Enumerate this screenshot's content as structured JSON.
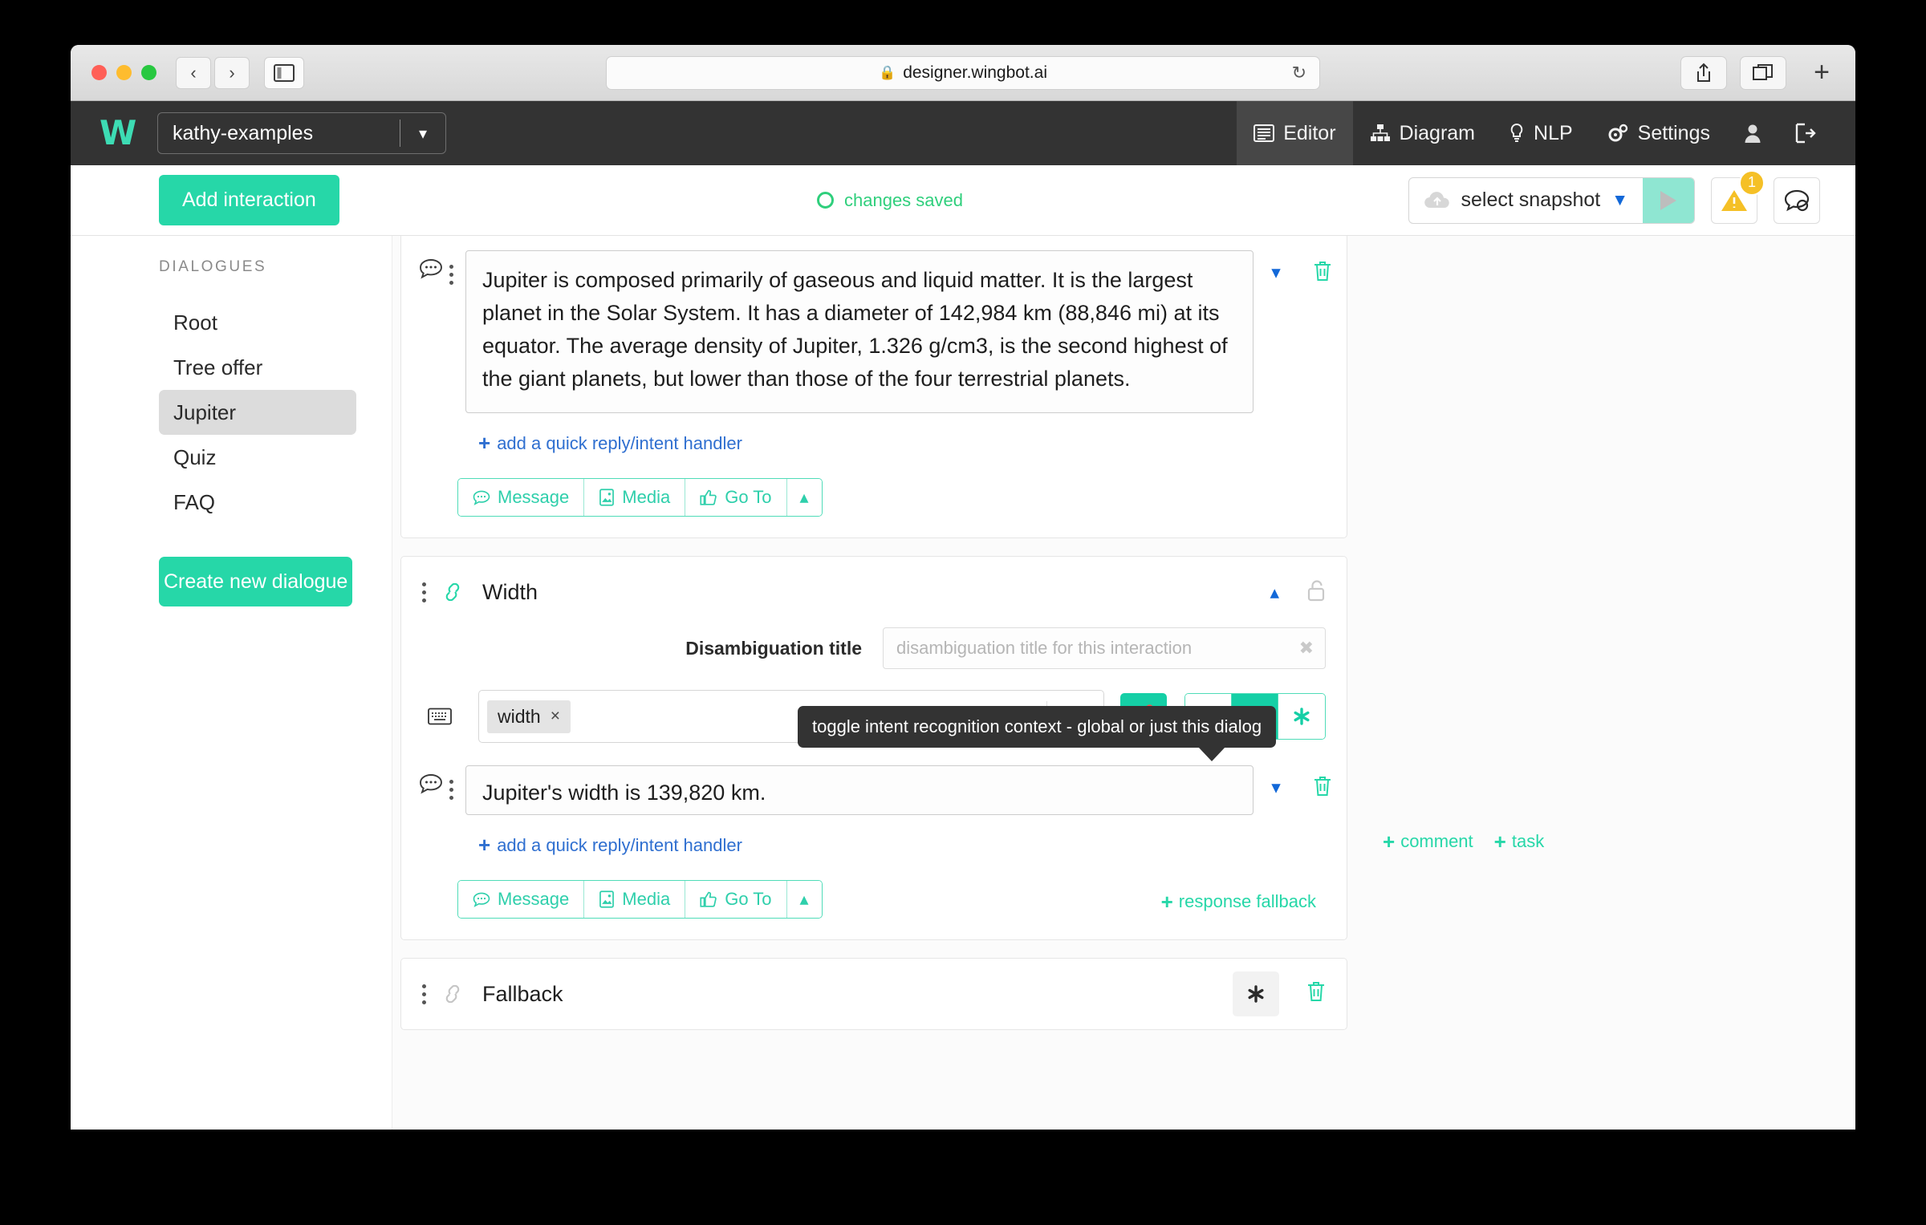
{
  "browser": {
    "url": "designer.wingbot.ai",
    "lock_icon": "lock-icon",
    "reload_icon": "reload-icon",
    "back_icon": "chevron-left-icon",
    "forward_icon": "chevron-right-icon",
    "sidebar_icon": "sidebar-toggle-icon",
    "share_icon": "share-icon",
    "tabs_icon": "tab-overview-icon",
    "new_tab_icon": "plus-icon"
  },
  "header": {
    "logo": "W",
    "project": "kathy-examples",
    "project_caret": "chevron-down-icon",
    "nav": [
      {
        "label": "Editor",
        "icon": "editor-icon",
        "active": true
      },
      {
        "label": "Diagram",
        "icon": "diagram-icon",
        "active": false
      },
      {
        "label": "NLP",
        "icon": "nlp-bulb-icon",
        "active": false
      },
      {
        "label": "Settings",
        "icon": "gears-icon",
        "active": false
      }
    ],
    "user_icon": "user-icon",
    "logout_icon": "logout-icon"
  },
  "toolbar": {
    "add_interaction": "Add interaction",
    "status": "changes saved",
    "snapshot_label": "select snapshot",
    "snapshot_icon": "cloud-upload-icon",
    "snapshot_caret": "chevron-down-icon",
    "play_icon": "play-icon",
    "warning_icon": "warning-triangle-icon",
    "warning_count": "1",
    "comments_icon": "comments-icon"
  },
  "sidebar": {
    "title": "DIALOGUES",
    "items": [
      {
        "label": "Root",
        "selected": false
      },
      {
        "label": "Tree offer",
        "selected": false
      },
      {
        "label": "Jupiter",
        "selected": true
      },
      {
        "label": "Quiz",
        "selected": false
      },
      {
        "label": "FAQ",
        "selected": false
      }
    ],
    "create_button": "Create new dialogue"
  },
  "aside": {
    "comment_link": "comment",
    "task_link": "task",
    "plus": "+"
  },
  "tooltip": {
    "text": "toggle intent recognition context - global or just this dialog"
  },
  "cards": {
    "jupiter_message": {
      "bubble_icon": "speech-bubble-icon",
      "drag_icon": "drag-handle-icon",
      "text": "Jupiter is composed primarily of gaseous and liquid matter. It is the largest planet in the Solar System. It has a diameter of 142,984 km (88,846 mi) at its equator. The average density of Jupiter, 1.326 g/cm3, is the second highest of the giant planets, but lower than those of the four terrestrial planets.",
      "expand_icon": "chevron-down-icon",
      "delete_icon": "trash-icon",
      "quick_reply": "add a quick reply/intent handler",
      "quick_reply_plus": "+",
      "buttons": [
        {
          "label": "Message",
          "icon": "speech-bubble-icon"
        },
        {
          "label": "Media",
          "icon": "image-icon"
        },
        {
          "label": "Go To",
          "icon": "thumbs-up-icon"
        }
      ],
      "collapse_icon": "chevron-up-icon"
    },
    "width": {
      "title": "Width",
      "link_icon": "link-icon",
      "drag_icon": "drag-handle-icon",
      "collapse_icon": "chevron-up-icon",
      "lock_icon": "unlock-icon",
      "disambiguation_label": "Disambiguation title",
      "disambiguation_value": "",
      "disambiguation_placeholder": "disambiguation title for this interaction",
      "disambiguation_clear_icon": "clear-circle-icon",
      "keyboard_icon": "keyboard-icon",
      "intent_chip": "width",
      "intent_chip_remove": "×",
      "intent_clear_icon": "clear-icon",
      "intent_caret_icon": "chevron-down-icon",
      "globe_button_icon": "globe-lock-icon",
      "segmented": [
        {
          "icon": "list-icon",
          "active": false
        },
        {
          "icon": "tag-icon",
          "active": true
        },
        {
          "icon": "asterisk-icon",
          "active": false
        }
      ],
      "message": {
        "bubble_icon": "speech-bubble-icon",
        "drag_icon": "drag-handle-icon",
        "text": "Jupiter's width is 139,820 km.",
        "expand_icon": "chevron-down-icon",
        "delete_icon": "trash-icon"
      },
      "quick_reply": "add a quick reply/intent handler",
      "quick_reply_plus": "+",
      "buttons": [
        {
          "label": "Message",
          "icon": "speech-bubble-icon"
        },
        {
          "label": "Media",
          "icon": "image-icon"
        },
        {
          "label": "Go To",
          "icon": "thumbs-up-icon"
        }
      ],
      "collapse_btn_icon": "chevron-up-icon",
      "response_fallback": "response fallback",
      "response_fallback_plus": "+"
    },
    "fallback": {
      "title": "Fallback",
      "link_icon": "link-icon",
      "drag_icon": "drag-handle-icon",
      "asterisk_icon": "asterisk-icon",
      "delete_icon": "trash-icon"
    }
  },
  "colors": {
    "accent": "#26d7a8",
    "accent_dark": "#15cfa6",
    "header_bg": "#333333",
    "link_blue": "#1268d8",
    "warning": "#f5c026",
    "status_green": "#2fcf7c"
  }
}
